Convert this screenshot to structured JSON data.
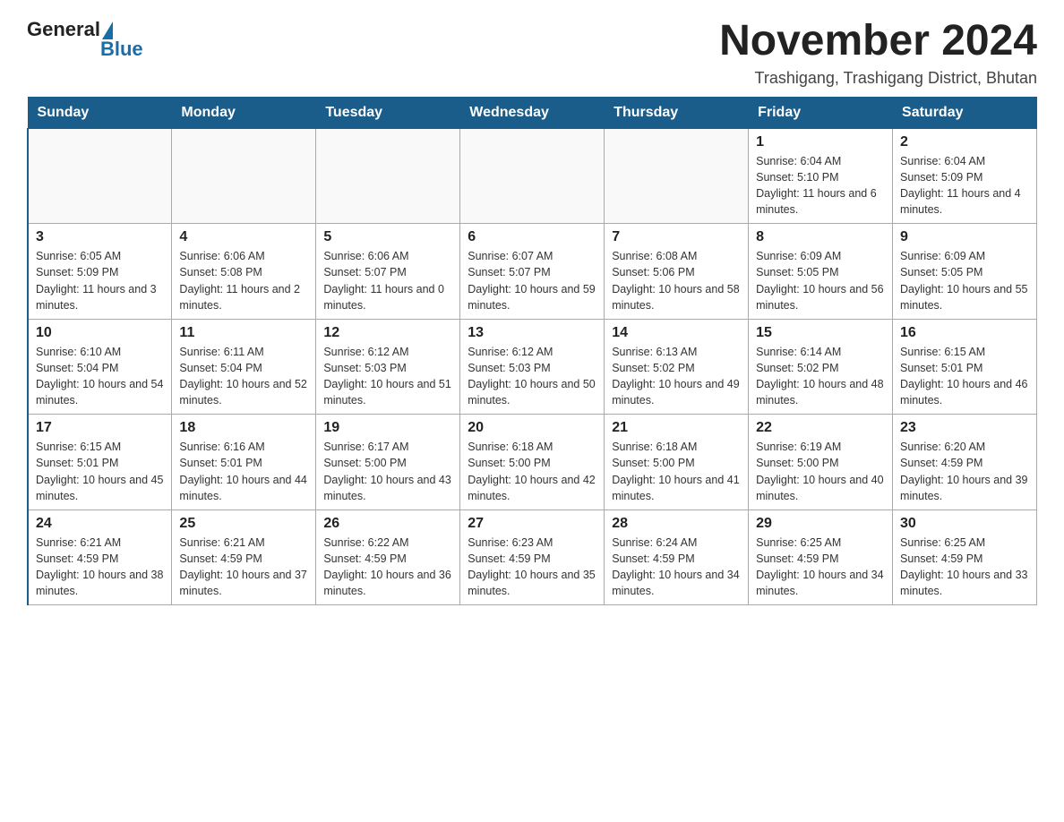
{
  "header": {
    "logo": {
      "general": "General",
      "blue": "Blue"
    },
    "title": "November 2024",
    "location": "Trashigang, Trashigang District, Bhutan"
  },
  "calendar": {
    "days": [
      "Sunday",
      "Monday",
      "Tuesday",
      "Wednesday",
      "Thursday",
      "Friday",
      "Saturday"
    ],
    "weeks": [
      [
        {
          "day": "",
          "info": ""
        },
        {
          "day": "",
          "info": ""
        },
        {
          "day": "",
          "info": ""
        },
        {
          "day": "",
          "info": ""
        },
        {
          "day": "",
          "info": ""
        },
        {
          "day": "1",
          "info": "Sunrise: 6:04 AM\nSunset: 5:10 PM\nDaylight: 11 hours and 6 minutes."
        },
        {
          "day": "2",
          "info": "Sunrise: 6:04 AM\nSunset: 5:09 PM\nDaylight: 11 hours and 4 minutes."
        }
      ],
      [
        {
          "day": "3",
          "info": "Sunrise: 6:05 AM\nSunset: 5:09 PM\nDaylight: 11 hours and 3 minutes."
        },
        {
          "day": "4",
          "info": "Sunrise: 6:06 AM\nSunset: 5:08 PM\nDaylight: 11 hours and 2 minutes."
        },
        {
          "day": "5",
          "info": "Sunrise: 6:06 AM\nSunset: 5:07 PM\nDaylight: 11 hours and 0 minutes."
        },
        {
          "day": "6",
          "info": "Sunrise: 6:07 AM\nSunset: 5:07 PM\nDaylight: 10 hours and 59 minutes."
        },
        {
          "day": "7",
          "info": "Sunrise: 6:08 AM\nSunset: 5:06 PM\nDaylight: 10 hours and 58 minutes."
        },
        {
          "day": "8",
          "info": "Sunrise: 6:09 AM\nSunset: 5:05 PM\nDaylight: 10 hours and 56 minutes."
        },
        {
          "day": "9",
          "info": "Sunrise: 6:09 AM\nSunset: 5:05 PM\nDaylight: 10 hours and 55 minutes."
        }
      ],
      [
        {
          "day": "10",
          "info": "Sunrise: 6:10 AM\nSunset: 5:04 PM\nDaylight: 10 hours and 54 minutes."
        },
        {
          "day": "11",
          "info": "Sunrise: 6:11 AM\nSunset: 5:04 PM\nDaylight: 10 hours and 52 minutes."
        },
        {
          "day": "12",
          "info": "Sunrise: 6:12 AM\nSunset: 5:03 PM\nDaylight: 10 hours and 51 minutes."
        },
        {
          "day": "13",
          "info": "Sunrise: 6:12 AM\nSunset: 5:03 PM\nDaylight: 10 hours and 50 minutes."
        },
        {
          "day": "14",
          "info": "Sunrise: 6:13 AM\nSunset: 5:02 PM\nDaylight: 10 hours and 49 minutes."
        },
        {
          "day": "15",
          "info": "Sunrise: 6:14 AM\nSunset: 5:02 PM\nDaylight: 10 hours and 48 minutes."
        },
        {
          "day": "16",
          "info": "Sunrise: 6:15 AM\nSunset: 5:01 PM\nDaylight: 10 hours and 46 minutes."
        }
      ],
      [
        {
          "day": "17",
          "info": "Sunrise: 6:15 AM\nSunset: 5:01 PM\nDaylight: 10 hours and 45 minutes."
        },
        {
          "day": "18",
          "info": "Sunrise: 6:16 AM\nSunset: 5:01 PM\nDaylight: 10 hours and 44 minutes."
        },
        {
          "day": "19",
          "info": "Sunrise: 6:17 AM\nSunset: 5:00 PM\nDaylight: 10 hours and 43 minutes."
        },
        {
          "day": "20",
          "info": "Sunrise: 6:18 AM\nSunset: 5:00 PM\nDaylight: 10 hours and 42 minutes."
        },
        {
          "day": "21",
          "info": "Sunrise: 6:18 AM\nSunset: 5:00 PM\nDaylight: 10 hours and 41 minutes."
        },
        {
          "day": "22",
          "info": "Sunrise: 6:19 AM\nSunset: 5:00 PM\nDaylight: 10 hours and 40 minutes."
        },
        {
          "day": "23",
          "info": "Sunrise: 6:20 AM\nSunset: 4:59 PM\nDaylight: 10 hours and 39 minutes."
        }
      ],
      [
        {
          "day": "24",
          "info": "Sunrise: 6:21 AM\nSunset: 4:59 PM\nDaylight: 10 hours and 38 minutes."
        },
        {
          "day": "25",
          "info": "Sunrise: 6:21 AM\nSunset: 4:59 PM\nDaylight: 10 hours and 37 minutes."
        },
        {
          "day": "26",
          "info": "Sunrise: 6:22 AM\nSunset: 4:59 PM\nDaylight: 10 hours and 36 minutes."
        },
        {
          "day": "27",
          "info": "Sunrise: 6:23 AM\nSunset: 4:59 PM\nDaylight: 10 hours and 35 minutes."
        },
        {
          "day": "28",
          "info": "Sunrise: 6:24 AM\nSunset: 4:59 PM\nDaylight: 10 hours and 34 minutes."
        },
        {
          "day": "29",
          "info": "Sunrise: 6:25 AM\nSunset: 4:59 PM\nDaylight: 10 hours and 34 minutes."
        },
        {
          "day": "30",
          "info": "Sunrise: 6:25 AM\nSunset: 4:59 PM\nDaylight: 10 hours and 33 minutes."
        }
      ]
    ]
  }
}
